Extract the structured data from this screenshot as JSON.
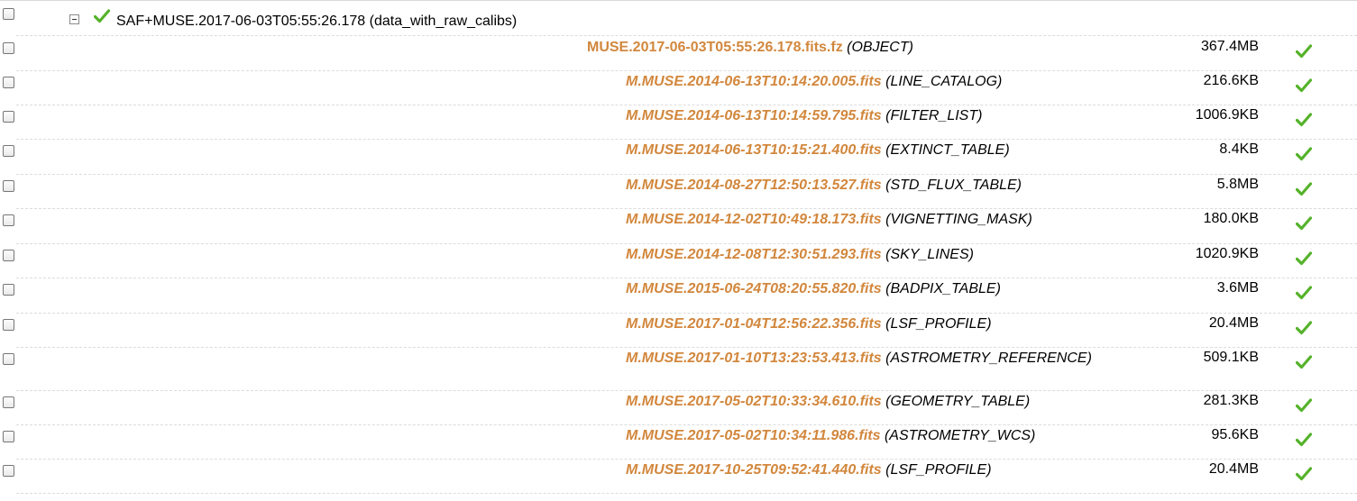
{
  "colors": {
    "link": "#d2873d",
    "check": "#55b22a",
    "divider": "#dcdcdc"
  },
  "dataset": {
    "label": "SAF+MUSE.2017-06-03T05:55:26.178 (data_with_raw_calibs)",
    "expander_icon": "collapse-minus-icon",
    "status_icon": "checkmark-icon"
  },
  "files": [
    {
      "name": "MUSE.2017-06-03T05:55:26.178.fits.fz",
      "category": "(OBJECT)",
      "size": "367.4MB",
      "kind": "science"
    },
    {
      "name": "M.MUSE.2014-06-13T10:14:20.005.fits",
      "category": "(LINE_CATALOG)",
      "size": "216.6KB",
      "kind": "calib"
    },
    {
      "name": "M.MUSE.2014-06-13T10:14:59.795.fits",
      "category": "(FILTER_LIST)",
      "size": "1006.9KB",
      "kind": "calib"
    },
    {
      "name": "M.MUSE.2014-06-13T10:15:21.400.fits",
      "category": "(EXTINCT_TABLE)",
      "size": "8.4KB",
      "kind": "calib"
    },
    {
      "name": "M.MUSE.2014-08-27T12:50:13.527.fits",
      "category": "(STD_FLUX_TABLE)",
      "size": "5.8MB",
      "kind": "calib"
    },
    {
      "name": "M.MUSE.2014-12-02T10:49:18.173.fits",
      "category": "(VIGNETTING_MASK)",
      "size": "180.0KB",
      "kind": "calib"
    },
    {
      "name": "M.MUSE.2014-12-08T12:30:51.293.fits",
      "category": "(SKY_LINES)",
      "size": "1020.9KB",
      "kind": "calib"
    },
    {
      "name": "M.MUSE.2015-06-24T08:20:55.820.fits",
      "category": "(BADPIX_TABLE)",
      "size": "3.6MB",
      "kind": "calib"
    },
    {
      "name": "M.MUSE.2017-01-04T12:56:22.356.fits",
      "category": "(LSF_PROFILE)",
      "size": "20.4MB",
      "kind": "calib"
    },
    {
      "name": "M.MUSE.2017-01-10T13:23:53.413.fits",
      "category": "(ASTROMETRY_REFERENCE)",
      "size": "509.1KB",
      "kind": "calib"
    },
    {
      "name": "M.MUSE.2017-05-02T10:33:34.610.fits",
      "category": "(GEOMETRY_TABLE)",
      "size": "281.3KB",
      "kind": "calib"
    },
    {
      "name": "M.MUSE.2017-05-02T10:34:11.986.fits",
      "category": "(ASTROMETRY_WCS)",
      "size": "95.6KB",
      "kind": "calib"
    },
    {
      "name": "M.MUSE.2017-10-25T09:52:41.440.fits",
      "category": "(LSF_PROFILE)",
      "size": "20.4MB",
      "kind": "calib"
    }
  ]
}
